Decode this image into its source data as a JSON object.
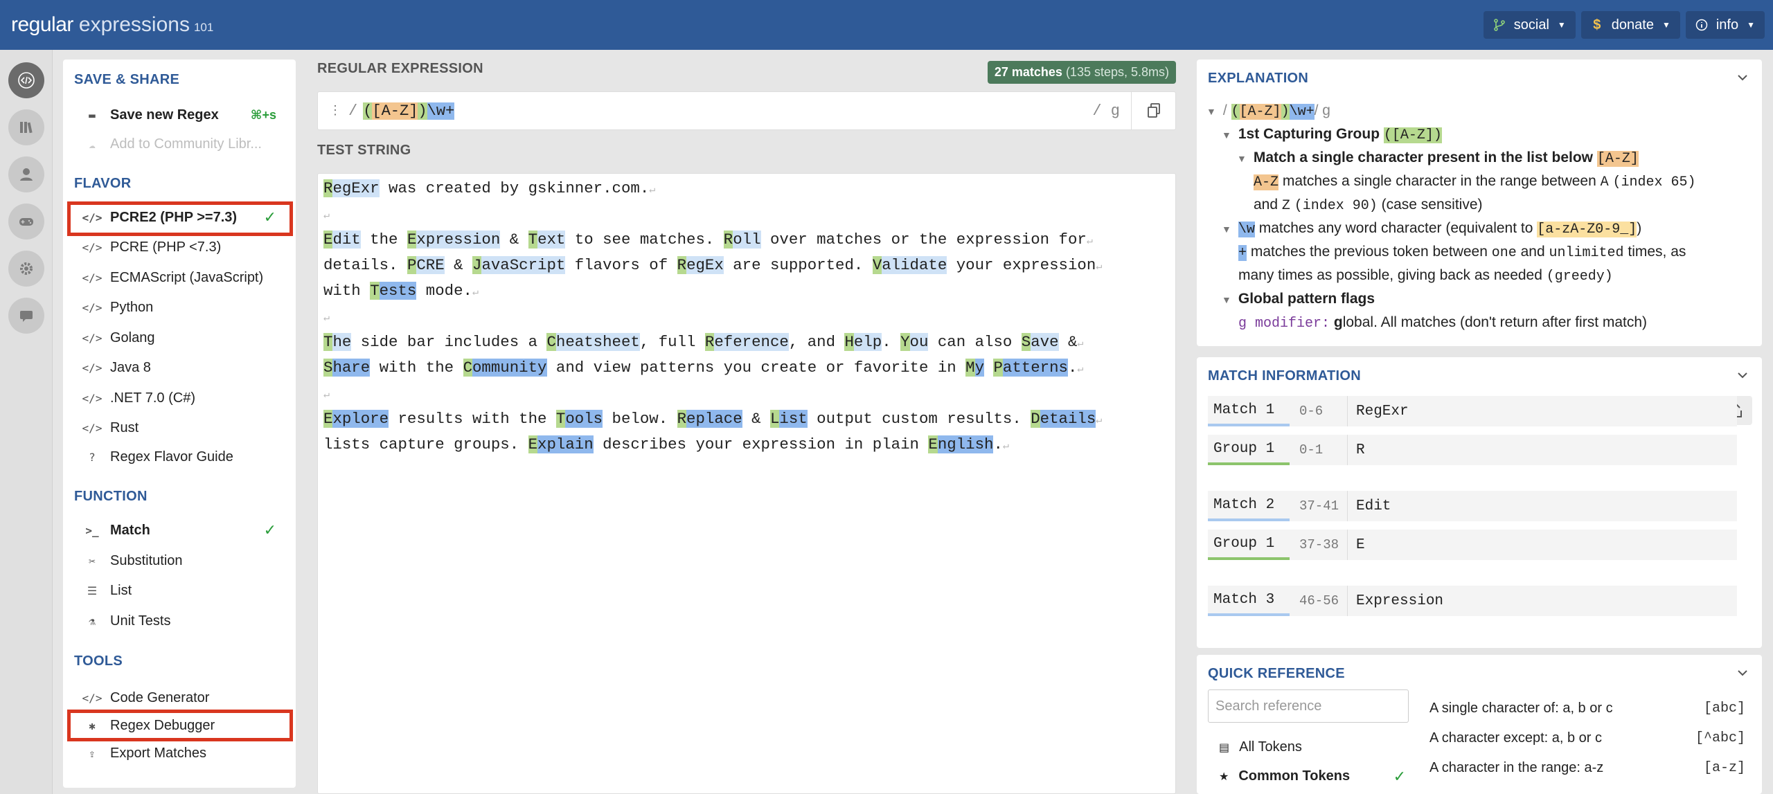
{
  "header": {
    "logo_main": "regular",
    "logo_second": "expressions",
    "logo_version": "101",
    "buttons": [
      {
        "label": "social",
        "icon": "branch-icon"
      },
      {
        "label": "donate",
        "icon": "dollar-icon"
      },
      {
        "label": "info",
        "icon": "info-icon"
      }
    ]
  },
  "sidebar": {
    "save_share_title": "SAVE & SHARE",
    "save_new": "Save new Regex",
    "save_shortcut": "⌘+s",
    "add_community": "Add to Community Libr...",
    "flavor_title": "FLAVOR",
    "flavors": [
      "PCRE2 (PHP >=7.3)",
      "PCRE (PHP <7.3)",
      "ECMAScript (JavaScript)",
      "Python",
      "Golang",
      "Java 8",
      ".NET 7.0 (C#)",
      "Rust",
      "Regex Flavor Guide"
    ],
    "function_title": "FUNCTION",
    "functions": [
      "Match",
      "Substitution",
      "List",
      "Unit Tests"
    ],
    "tools_title": "TOOLS",
    "tools": [
      "Code Generator",
      "Regex Debugger",
      "Export Matches"
    ]
  },
  "editor": {
    "regex_label": "REGULAR EXPRESSION",
    "badge_count": "27 matches",
    "badge_detail": "(135 steps, 5.8ms)",
    "regex_open": "(",
    "regex_set": "[A-Z]",
    "regex_close": ")",
    "regex_word": "\\w+",
    "delimiter": "/",
    "flags": "/ g",
    "test_label": "TEST STRING"
  },
  "explanation": {
    "title": "EXPLANATION",
    "root_pattern": "([A-Z])\\w+",
    "root_flags": "/ g",
    "group1_title": "1st Capturing Group",
    "group1_token": "([A-Z])",
    "match_single": "Match a single character present in the list below",
    "set_token": "[A-Z]",
    "range_token": "A-Z",
    "range_desc": "matches a single character in the range between",
    "range_a": "A",
    "index65": "(index 65)",
    "and_word": "and",
    "range_z": "Z",
    "index90": "(index 90)",
    "case_sensitive": "(case sensitive)",
    "w_token": "\\w",
    "w_desc": "matches any word character (equivalent to",
    "w_class": "[a-zA-Z0-9_]",
    "w_close": ")",
    "plus_token": "+",
    "plus_desc1": "matches the previous token between",
    "plus_one": "one",
    "plus_and": "and",
    "plus_unlimited": "unlimited",
    "plus_desc2": "times, as",
    "plus_desc3": "many times as possible, giving back as needed",
    "plus_greedy": "(greedy)",
    "flags_title": "Global pattern flags",
    "g_modifier": "g modifier:",
    "g_desc_bold": "g",
    "g_desc": "lobal. All matches (don't return after first match)"
  },
  "match_info": {
    "title": "MATCH INFORMATION",
    "rows": [
      {
        "label": "Match 1",
        "range": "0-6",
        "value": "RegExr",
        "kind": "match"
      },
      {
        "label": "Group 1",
        "range": "0-1",
        "value": "R",
        "kind": "group"
      },
      {
        "label": "Match 2",
        "range": "37-41",
        "value": "Edit",
        "kind": "match"
      },
      {
        "label": "Group 1",
        "range": "37-38",
        "value": "E",
        "kind": "group"
      },
      {
        "label": "Match 3",
        "range": "46-56",
        "value": "Expression",
        "kind": "match"
      }
    ]
  },
  "quick_ref": {
    "title": "QUICK REFERENCE",
    "search_placeholder": "Search reference",
    "categories": [
      "All Tokens",
      "Common Tokens"
    ],
    "refs": [
      {
        "desc": "A single character of: a, b or c",
        "code": "[abc]"
      },
      {
        "desc": "A character except: a, b or c",
        "code": "[^abc]"
      },
      {
        "desc": "A character in the range: a-z",
        "code": "[a-z]"
      }
    ]
  },
  "test_string": {
    "lines": [
      [
        [
          "RegExr",
          "m"
        ],
        [
          " was created by gskinner.com.",
          ""
        ]
      ],
      [],
      [
        [
          "Edit",
          "m"
        ],
        [
          " the ",
          ""
        ],
        [
          "Expression",
          "m"
        ],
        [
          " & ",
          ""
        ],
        [
          "Text",
          "m"
        ],
        [
          " to see matches. ",
          ""
        ],
        [
          "Roll",
          "m"
        ],
        [
          " over matches or the expression for",
          ""
        ]
      ],
      [
        [
          "details. ",
          ""
        ],
        [
          "PCRE",
          "m"
        ],
        [
          " & ",
          ""
        ],
        [
          "JavaScript",
          "m"
        ],
        [
          " flavors of ",
          ""
        ],
        [
          "RegEx",
          "m"
        ],
        [
          " are supported. ",
          ""
        ],
        [
          "Validate",
          "m"
        ],
        [
          " your expression",
          ""
        ]
      ],
      [
        [
          "with ",
          ""
        ],
        [
          "Tests",
          "m"
        ],
        [
          " mode.",
          ""
        ]
      ],
      [],
      [
        [
          "The",
          "m"
        ],
        [
          " side bar includes a ",
          ""
        ],
        [
          "Cheatsheet",
          "m"
        ],
        [
          ", full ",
          ""
        ],
        [
          "Reference",
          "m"
        ],
        [
          ", and ",
          ""
        ],
        [
          "Help",
          "m"
        ],
        [
          ". ",
          ""
        ],
        [
          "You",
          "m"
        ],
        [
          " can also ",
          ""
        ],
        [
          "Save",
          "m"
        ],
        [
          " &",
          ""
        ]
      ],
      [
        [
          "Share",
          "m"
        ],
        [
          " with the ",
          ""
        ],
        [
          "Community",
          "m"
        ],
        [
          " and view patterns you create or favorite in ",
          ""
        ],
        [
          "My",
          "m"
        ],
        [
          " ",
          ""
        ],
        [
          "Patterns",
          "m"
        ],
        [
          ".",
          ""
        ]
      ],
      [],
      [
        [
          "Explore",
          "m"
        ],
        [
          " results with the ",
          ""
        ],
        [
          "Tools",
          "m"
        ],
        [
          " below. ",
          ""
        ],
        [
          "Replace",
          "m"
        ],
        [
          " & ",
          ""
        ],
        [
          "List",
          "m"
        ],
        [
          " output custom results. ",
          ""
        ],
        [
          "Details",
          "m"
        ],
        [
          "",
          ""
        ]
      ],
      [
        [
          "lists capture groups. ",
          ""
        ],
        [
          "Explain",
          "m"
        ],
        [
          " describes your expression in plain ",
          ""
        ],
        [
          "English",
          "m"
        ],
        [
          ".",
          ""
        ]
      ]
    ]
  }
}
